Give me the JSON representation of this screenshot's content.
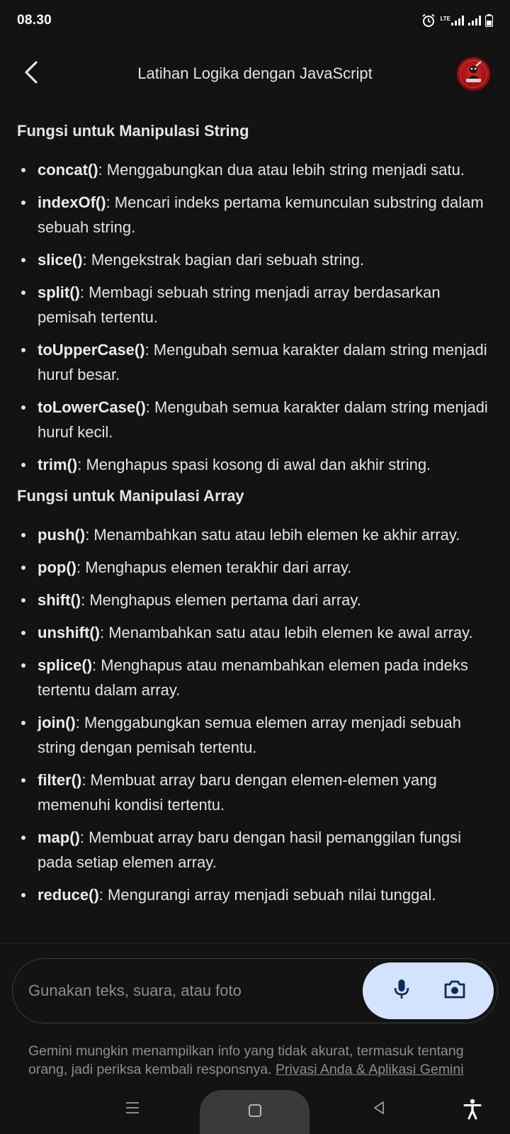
{
  "status_bar": {
    "time": "08.30",
    "network_label": "LTE",
    "icons": [
      "alarm-icon",
      "lte-signal-icon",
      "signal-icon",
      "battery-icon"
    ]
  },
  "header": {
    "title": "Latihan Logika dengan JavaScript",
    "back_icon": "arrow-back-icon",
    "avatar": "profile-avatar"
  },
  "sections": [
    {
      "heading": "Fungsi untuk Manipulasi String",
      "items": [
        {
          "name": "concat()",
          "desc": ": Menggabungkan dua atau lebih string menjadi satu."
        },
        {
          "name": "indexOf()",
          "desc": ": Mencari indeks pertama kemunculan substring dalam sebuah string."
        },
        {
          "name": "slice()",
          "desc": ": Mengekstrak bagian dari sebuah string."
        },
        {
          "name": "split()",
          "desc": ": Membagi sebuah string menjadi array berdasarkan pemisah tertentu."
        },
        {
          "name": "toUpperCase()",
          "desc": ": Mengubah semua karakter dalam string menjadi huruf besar."
        },
        {
          "name": "toLowerCase()",
          "desc": ": Mengubah semua karakter dalam string menjadi huruf kecil."
        },
        {
          "name": "trim()",
          "desc": ": Menghapus spasi kosong di awal dan akhir string."
        }
      ]
    },
    {
      "heading": "Fungsi untuk Manipulasi Array",
      "items": [
        {
          "name": "push()",
          "desc": ": Menambahkan satu atau lebih elemen ke akhir array."
        },
        {
          "name": "pop()",
          "desc": ": Menghapus elemen terakhir dari array."
        },
        {
          "name": "shift()",
          "desc": ": Menghapus elemen pertama dari array."
        },
        {
          "name": "unshift()",
          "desc": ": Menambahkan satu atau lebih elemen ke awal array."
        },
        {
          "name": "splice()",
          "desc": ": Menghapus atau menambahkan elemen pada indeks tertentu dalam array."
        },
        {
          "name": "join()",
          "desc": ": Menggabungkan semua elemen array menjadi sebuah string dengan pemisah tertentu."
        },
        {
          "name": "filter()",
          "desc": ": Membuat array baru dengan elemen-elemen yang memenuhi kondisi tertentu."
        },
        {
          "name": "map()",
          "desc": ": Membuat array baru dengan hasil pemanggilan fungsi pada setiap elemen array."
        },
        {
          "name": "reduce()",
          "desc": ": Mengurangi array menjadi sebuah nilai tunggal."
        }
      ]
    }
  ],
  "composer": {
    "placeholder": "Gunakan teks, suara, atau foto",
    "mic_icon": "microphone-icon",
    "camera_icon": "camera-icon",
    "pill_color": "#d3e3fd"
  },
  "disclaimer": {
    "text": "Gemini mungkin menampilkan info yang tidak akurat, termasuk tentang orang, jadi periksa kembali responsnya. ",
    "link": "Privasi Anda & Aplikasi Gemini"
  },
  "nav_bar": {
    "icons": [
      "recent-apps-icon",
      "home-icon",
      "back-icon",
      "accessibility-icon"
    ]
  },
  "colors": {
    "background": "#131314",
    "text": "#e3e3e3",
    "muted": "#8e8e92",
    "accent_pill": "#d3e3fd",
    "icon_dark": "#0b2a5c"
  }
}
